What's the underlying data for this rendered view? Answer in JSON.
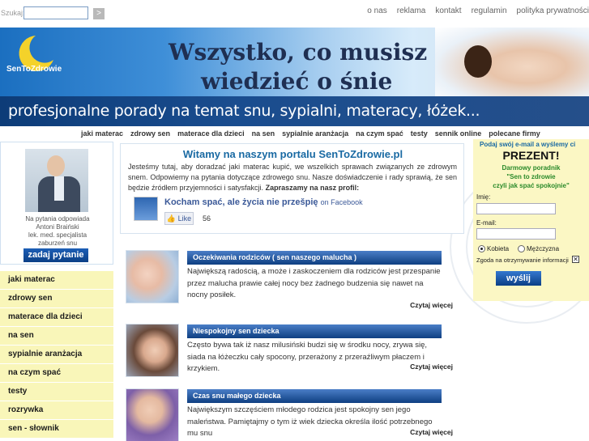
{
  "search": {
    "label": "Szukaj:",
    "placeholder": "",
    "button": ">"
  },
  "top_links": [
    "o nas",
    "reklama",
    "kontakt",
    "regulamin",
    "polityka prywatności"
  ],
  "banner": {
    "logo_text": "SenToZdrowie",
    "headline_line1": "Wszystko, co musisz",
    "headline_line2": "wiedzieć o śnie",
    "tagline": "profesjonalne porady na temat snu, sypialni, materacy, łóżek..."
  },
  "nav": [
    "jaki materac",
    "zdrowy sen",
    "materace dla dzieci",
    "na sen",
    "sypialnie aranżacja",
    "na czym spać",
    "testy",
    "sennik online",
    "polecane firmy"
  ],
  "doctor": {
    "caption_lines": [
      "Na pytania odpowiada",
      "Antoni Braiński",
      "lek. med. specjalista",
      "zaburzeń snu"
    ],
    "ask_button": "zadaj pytanie"
  },
  "side_menu": [
    "jaki materac",
    "zdrowy sen",
    "materace dla dzieci",
    "na sen",
    "sypialnie aranżacja",
    "na czym spać",
    "testy",
    "rozrywka",
    "sen - słownik"
  ],
  "welcome": {
    "title": "Witamy na naszym portalu SenToZdrowie.pl",
    "text": "Jesteśmy tutaj, aby doradzać jaki materac kupić, we wszelkich sprawach związanych ze zdrowym snem. Odpowiemy na pytania dotyczące zdrowego snu. Nasze doświadczenie i rady sprawią, że sen będzie źródłem przyjemności i satysfakcji.",
    "bold_tail": "Zapraszamy na nasz profil:",
    "fb_title": "Kocham spać, ale życia nie przešpię",
    "fb_on": "on Facebook",
    "like_label": "Like",
    "like_count": "56"
  },
  "articles": [
    {
      "title": "Oczekiwania rodziców ( sen naszego malucha )",
      "text": "Największą radością, a może i zaskoczeniem dla rodziców jest przespanie przez malucha prawie całej nocy bez żadnego budzenia się nawet na nocny posiłek.",
      "more": "Czytaj więcej"
    },
    {
      "title": "Niespokojny sen dziecka",
      "text": "Często bywa tak iż nasz milusiński budzi się w środku nocy, zrywa się, siada na łóżeczku cały spocony, przerażony z przeraźliwym płaczem i krzykiem.",
      "more": "Czytaj więcej"
    },
    {
      "title": "Czas snu małego dziecka",
      "text": "Największym szczęściem młodego rodzica jest spokojny sen jego maleństwa. Pamiętajmy o tym iż wiek dziecka określa ilość potrzebnego mu snu",
      "more": "Czytaj więcej"
    }
  ],
  "signup": {
    "top": "Podaj swój e-mail a wyślemy ci",
    "prezent": "PREZENT!",
    "offer_lines": [
      "Darmowy poradnik",
      "\"Sen to zdrowie",
      "czyli jak spać spokojnie\""
    ],
    "name_label": "Imię:",
    "email_label": "E-mail:",
    "female": "Kobieta",
    "male": "Mężczyzna",
    "agree": "Zgoda na otrzymywanie informacji",
    "send": "wyślij"
  }
}
